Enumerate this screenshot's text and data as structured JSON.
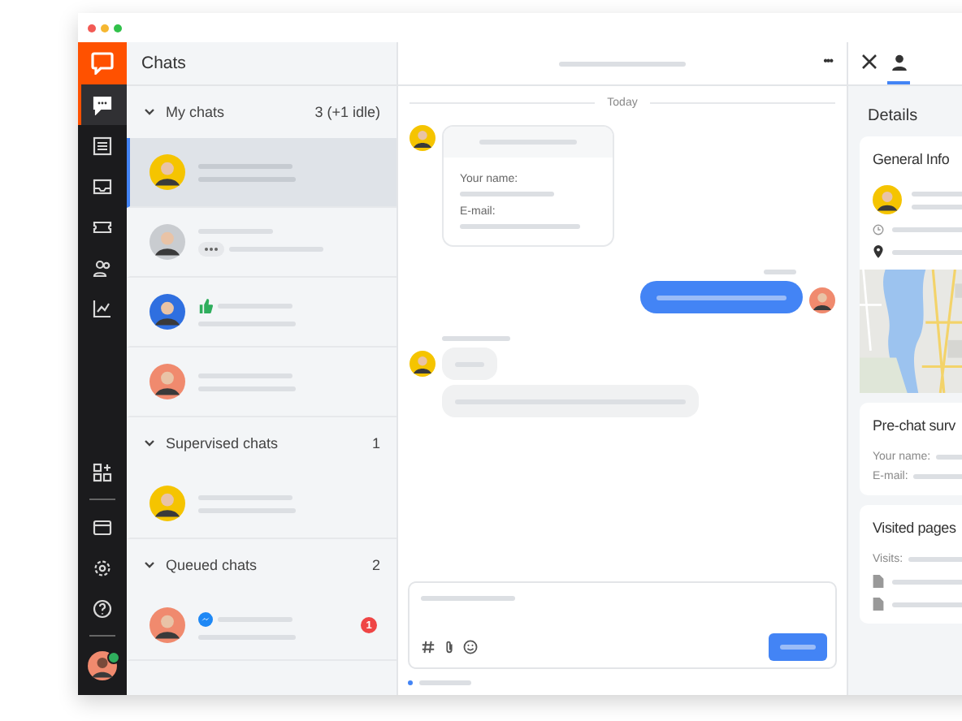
{
  "rail": {
    "top": [
      {
        "kind": "chats",
        "selected": true
      },
      {
        "kind": "list",
        "selected": false
      },
      {
        "kind": "inbox",
        "selected": false
      },
      {
        "kind": "ticket",
        "selected": false
      },
      {
        "kind": "people",
        "selected": false
      },
      {
        "kind": "chart",
        "selected": false
      }
    ],
    "bottom": [
      {
        "kind": "apps",
        "selected": false
      },
      {
        "kind": "window",
        "selected": false
      },
      {
        "kind": "settings",
        "selected": false
      },
      {
        "kind": "help",
        "selected": false
      }
    ],
    "user": {
      "online": true,
      "color": "#f08a6e"
    }
  },
  "chats_panel": {
    "title": "Chats",
    "sections": [
      {
        "title": "My chats",
        "count": "3 (+1 idle)",
        "expanded": true,
        "chats": [
          {
            "kind": "plain",
            "selected": true,
            "color": "#f5c400"
          },
          {
            "kind": "typing",
            "selected": false,
            "color": "#c9ccd0"
          },
          {
            "kind": "rating",
            "selected": false,
            "color": "#2f6fe0"
          },
          {
            "kind": "plain",
            "selected": false,
            "color": "#f08a6e"
          }
        ]
      },
      {
        "title": "Supervised chats",
        "count": "1",
        "expanded": true,
        "chats": [
          {
            "kind": "plain",
            "selected": false,
            "color": "#f5c400"
          }
        ]
      },
      {
        "title": "Queued chats",
        "count": "2",
        "expanded": true,
        "chats": [
          {
            "kind": "messenger",
            "selected": false,
            "color": "#f08a6e",
            "unread": "1"
          }
        ]
      }
    ]
  },
  "conversation": {
    "menu": "•••",
    "date": "Today",
    "form": {
      "fields": [
        "Your name:",
        "E-mail:"
      ]
    }
  },
  "details": {
    "tabs": [
      {
        "kind": "close",
        "selected": false
      },
      {
        "kind": "person",
        "selected": true
      }
    ],
    "title": "Details",
    "general": {
      "title": "General Info",
      "color": "#f5c400"
    },
    "survey": {
      "title": "Pre-chat surv",
      "fields": [
        "Your name:",
        "E-mail:"
      ]
    },
    "visited": {
      "title": "Visited pages",
      "label": "Visits:"
    }
  }
}
